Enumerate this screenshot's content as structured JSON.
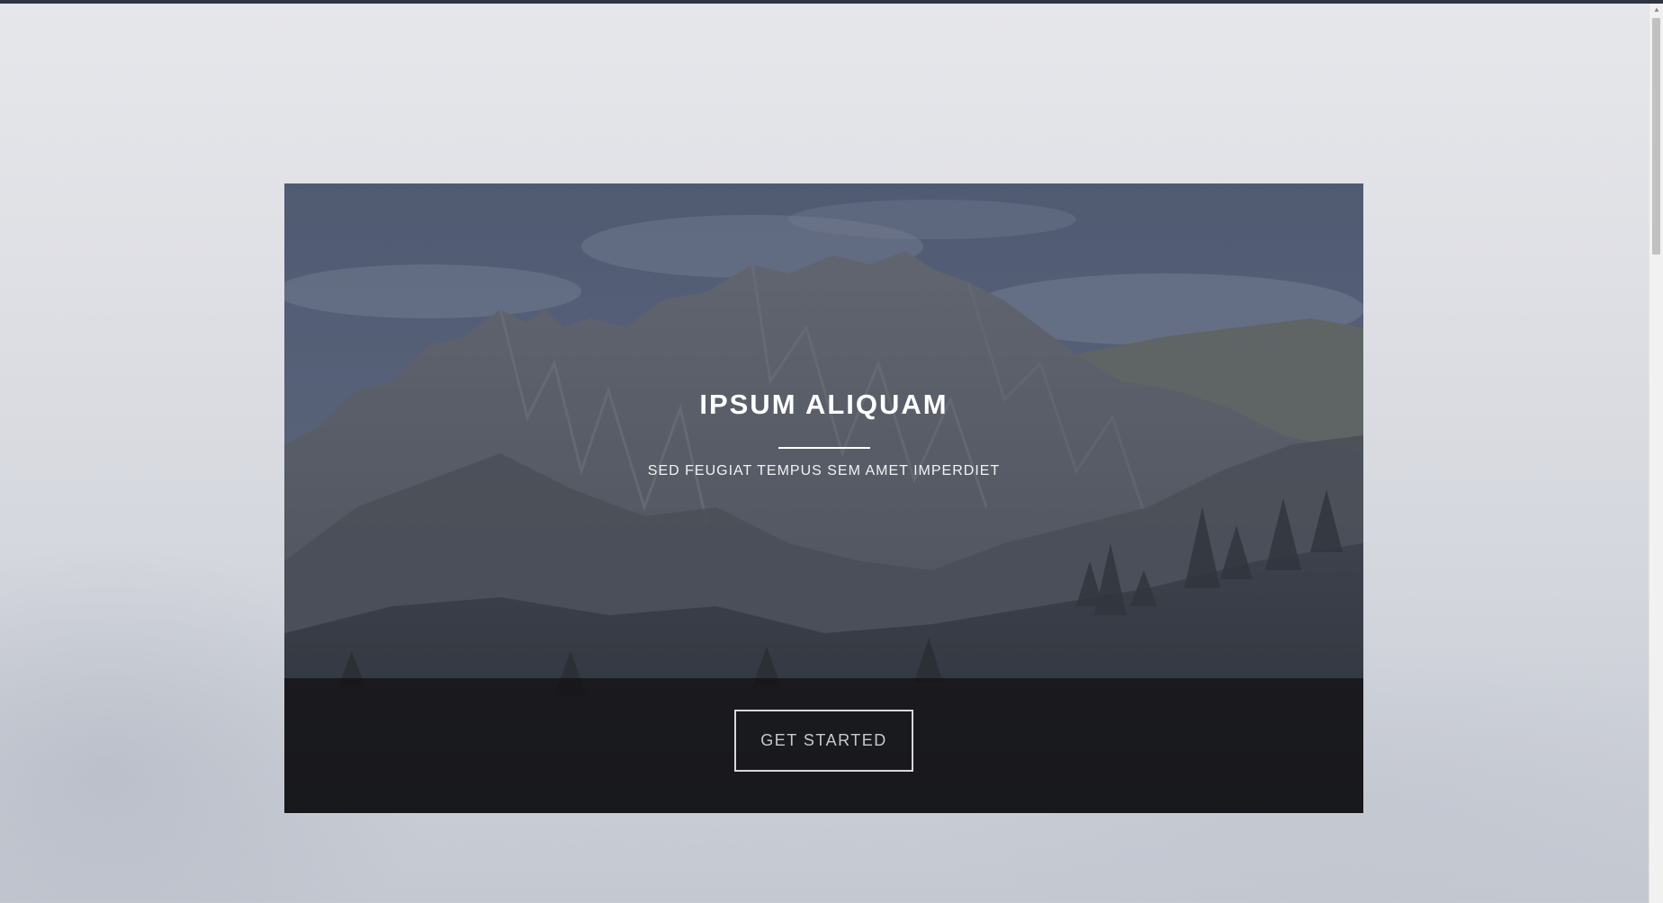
{
  "banner": {
    "title": "IPSUM ALIQUAM",
    "subtitle": "SED FEUGIAT TEMPUS SEM AMET IMPERDIET",
    "cta_label": "GET STARTED"
  },
  "scrollbar": {
    "up_arrow_icon": "scroll-up-arrow"
  },
  "colors": {
    "background": "#e2e3e7",
    "footer_band": "#1a1a1e",
    "text": "#ffffff",
    "button_border": "#d8d8d8"
  }
}
